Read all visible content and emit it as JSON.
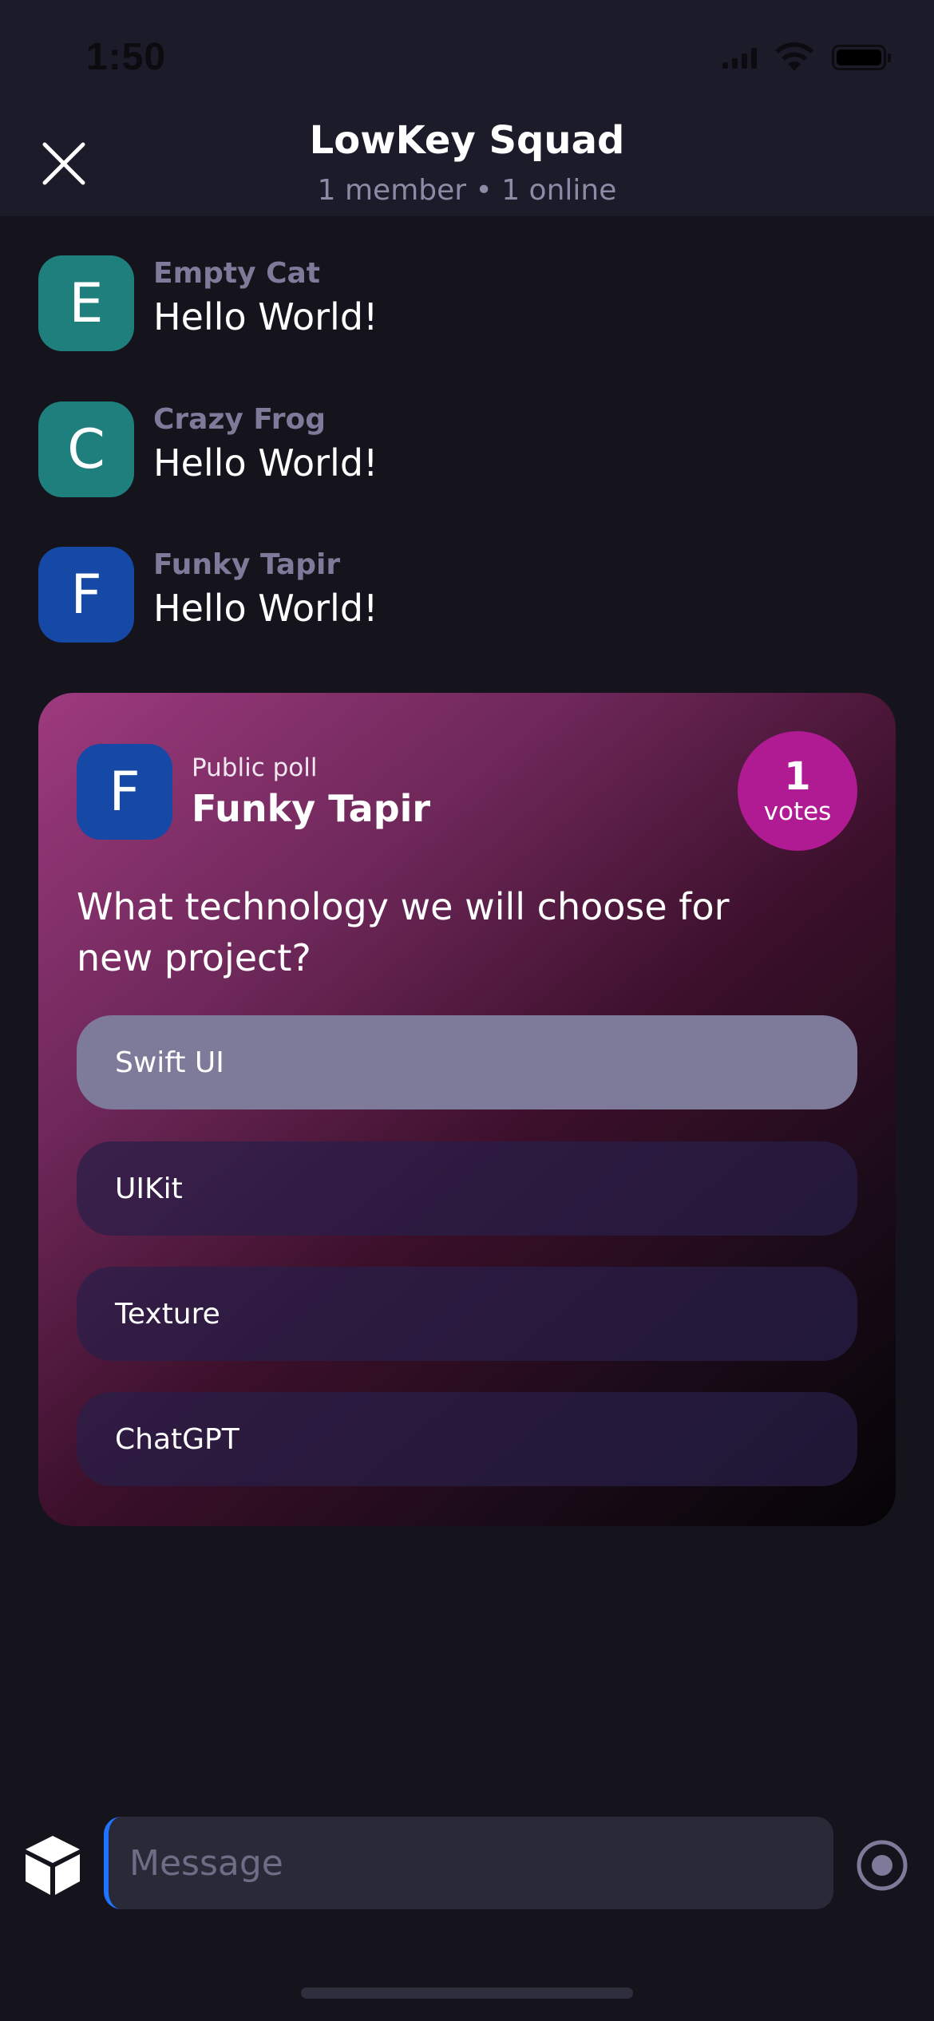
{
  "status_bar": {
    "time": "1:50"
  },
  "header": {
    "title": "LowKey Squad",
    "subtitle": "1 member • 1 online"
  },
  "messages": [
    {
      "initial": "E",
      "name": "Empty Cat",
      "text": "Hello World!",
      "avatar_color": "#1f7f7c"
    },
    {
      "initial": "C",
      "name": "Crazy Frog",
      "text": "Hello World!",
      "avatar_color": "#1f7f7c"
    },
    {
      "initial": "F",
      "name": "Funky Tapir",
      "text": "Hello World!",
      "avatar_color": "#1648a6"
    }
  ],
  "poll": {
    "author_initial": "F",
    "kind_label": "Public poll",
    "author": "Funky Tapir",
    "votes_count": "1",
    "votes_label": "votes",
    "question": "What technology we will choose for new project?",
    "options": [
      {
        "label": "Swift UI",
        "selected": true
      },
      {
        "label": "UIKit",
        "selected": false
      },
      {
        "label": "Texture",
        "selected": false
      },
      {
        "label": "ChatGPT",
        "selected": false
      }
    ],
    "badge_color": "#b01b94"
  },
  "composer": {
    "placeholder": "Message",
    "left_icon": "cube-icon",
    "right_icon": "record-icon"
  },
  "colors": {
    "background": "#15141c",
    "header_background": "#1c1b29",
    "selected_option": "#7d7a9a",
    "cursor": "#1f73ff"
  }
}
